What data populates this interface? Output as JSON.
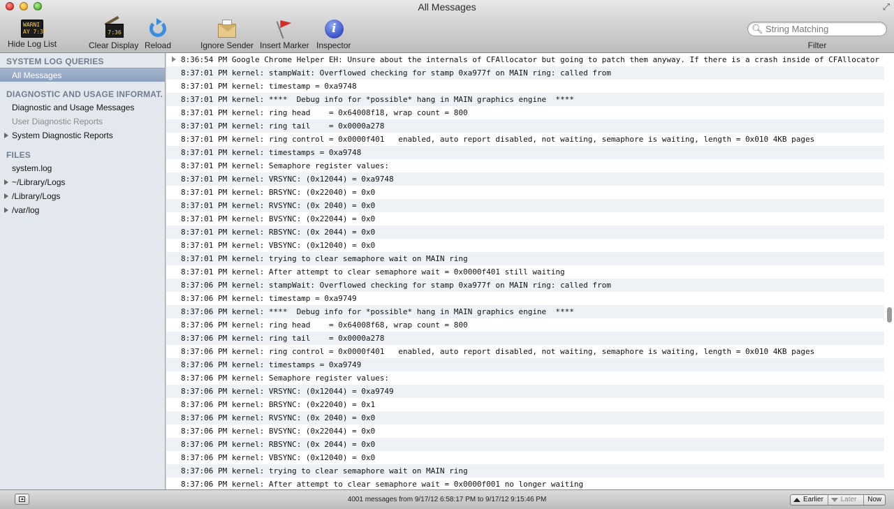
{
  "window": {
    "title": "All Messages"
  },
  "toolbar": {
    "hide_log_list": {
      "label": "Hide Log List",
      "icon": "console-icon",
      "icon_text_1": "WARNI",
      "icon_text_2": "AY 7:36"
    },
    "clear_display": {
      "label": "Clear Display",
      "icon": "broom-icon",
      "icon_text": "7:36"
    },
    "reload": {
      "label": "Reload",
      "icon": "reload-icon"
    },
    "ignore_sender": {
      "label": "Ignore Sender",
      "icon": "envelope-icon"
    },
    "insert_marker": {
      "label": "Insert Marker",
      "icon": "flag-icon"
    },
    "inspector": {
      "label": "Inspector",
      "icon": "info-icon",
      "icon_text": "i"
    },
    "search": {
      "placeholder": "String Matching",
      "value": ""
    },
    "filter_label": "Filter"
  },
  "sidebar": {
    "section_queries": "SYSTEM LOG QUERIES",
    "all_messages": "All Messages",
    "section_diagnostic": "DIAGNOSTIC AND USAGE INFORMAT...",
    "diag_messages": "Diagnostic and Usage Messages",
    "user_diag_reports": "User Diagnostic Reports",
    "system_diag_reports": "System Diagnostic Reports",
    "section_files": "FILES",
    "system_log": "system.log",
    "user_library_logs": "~/Library/Logs",
    "library_logs": "/Library/Logs",
    "var_log": "/var/log"
  },
  "log_rows": [
    "8:36:54 PM Google Chrome Helper EH: Unsure about the internals of CFAllocator but going to patch them anyway. If there is a crash inside of CFAllocator",
    "8:37:01 PM kernel: stampWait: Overflowed checking for stamp 0xa977f on MAIN ring: called from",
    "8:37:01 PM kernel: timestamp = 0xa9748",
    "8:37:01 PM kernel: ****  Debug info for *possible* hang in MAIN graphics engine  ****",
    "8:37:01 PM kernel: ring head    = 0x64008f18, wrap count = 800",
    "8:37:01 PM kernel: ring tail    = 0x0000a278",
    "8:37:01 PM kernel: ring control = 0x0000f401   enabled, auto report disabled, not waiting, semaphore is waiting, length = 0x010 4KB pages",
    "8:37:01 PM kernel: timestamps = 0xa9748",
    "8:37:01 PM kernel: Semaphore register values:",
    "8:37:01 PM kernel: VRSYNC: (0x12044) = 0xa9748",
    "8:37:01 PM kernel: BRSYNC: (0x22040) = 0x0",
    "8:37:01 PM kernel: RVSYNC: (0x 2040) = 0x0",
    "8:37:01 PM kernel: BVSYNC: (0x22044) = 0x0",
    "8:37:01 PM kernel: RBSYNC: (0x 2044) = 0x0",
    "8:37:01 PM kernel: VBSYNC: (0x12040) = 0x0",
    "8:37:01 PM kernel: trying to clear semaphore wait on MAIN ring",
    "8:37:01 PM kernel: After attempt to clear semaphore wait = 0x0000f401 still waiting",
    "8:37:06 PM kernel: stampWait: Overflowed checking for stamp 0xa977f on MAIN ring: called from",
    "8:37:06 PM kernel: timestamp = 0xa9749",
    "8:37:06 PM kernel: ****  Debug info for *possible* hang in MAIN graphics engine  ****",
    "8:37:06 PM kernel: ring head    = 0x64008f68, wrap count = 800",
    "8:37:06 PM kernel: ring tail    = 0x0000a278",
    "8:37:06 PM kernel: ring control = 0x0000f401   enabled, auto report disabled, not waiting, semaphore is waiting, length = 0x010 4KB pages",
    "8:37:06 PM kernel: timestamps = 0xa9749",
    "8:37:06 PM kernel: Semaphore register values:",
    "8:37:06 PM kernel: VRSYNC: (0x12044) = 0xa9749",
    "8:37:06 PM kernel: BRSYNC: (0x22040) = 0x1",
    "8:37:06 PM kernel: RVSYNC: (0x 2040) = 0x0",
    "8:37:06 PM kernel: BVSYNC: (0x22044) = 0x0",
    "8:37:06 PM kernel: RBSYNC: (0x 2044) = 0x0",
    "8:37:06 PM kernel: VBSYNC: (0x12040) = 0x0",
    "8:37:06 PM kernel: trying to clear semaphore wait on MAIN ring",
    "8:37:06 PM kernel: After attempt to clear semaphore wait = 0x0000f001 no longer waiting"
  ],
  "status": {
    "summary": "4001 messages from 9/17/12 6:58:17 PM to 9/17/12 9:15:46 PM",
    "earlier": "Earlier",
    "later": "Later",
    "now": "Now"
  },
  "colors": {
    "selection": "#8ba0be",
    "sidebar_bg": "#e3e8ee",
    "row_alt": "#eef2f7"
  }
}
